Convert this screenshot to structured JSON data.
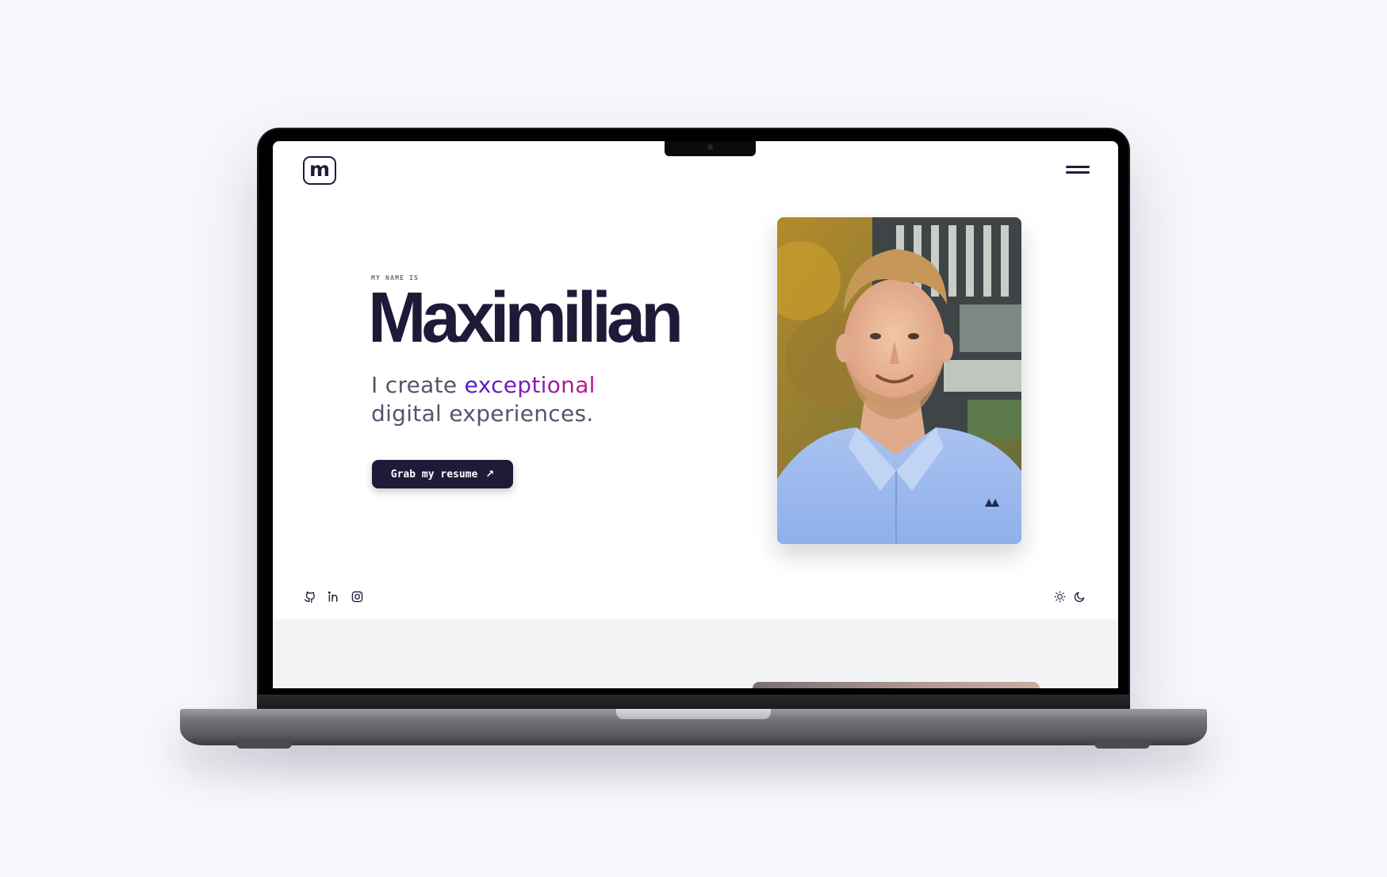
{
  "site": {
    "logo_letter": "m",
    "eyebrow": "MY NAME IS",
    "name": "Maximilian",
    "tagline_prefix": "I create",
    "tagline_highlight": "exceptional",
    "tagline_suffix": "digital experiences.",
    "resume_button": "Grab my resume",
    "resume_arrow": "↗"
  },
  "icons": {
    "menu": "hamburger-menu-icon",
    "socials": [
      "github-icon",
      "linkedin-icon",
      "instagram-icon"
    ],
    "theme": [
      "sun-icon",
      "moon-icon"
    ]
  },
  "colors": {
    "brand_dark": "#1e1b39",
    "gradient_start": "#4a1fd1",
    "gradient_end": "#c41a86",
    "page_bg": "#f6f6fb"
  }
}
